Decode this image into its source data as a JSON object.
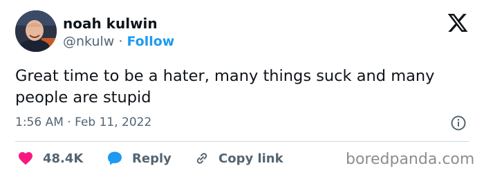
{
  "author": {
    "name": "noah kulwin",
    "handle": "@nkulw",
    "separator": "·",
    "follow_label": "Follow"
  },
  "platform_logo_icon": "x-logo-icon",
  "tweet": {
    "text": "Great time to be a hater, many things suck and many people are stupid",
    "time": "1:56 AM",
    "date": "Feb 11, 2022",
    "meta_separator": "·"
  },
  "actions": {
    "like_count": "48.4K",
    "reply_label": "Reply",
    "copy_link_label": "Copy link"
  },
  "icons": [
    "heart-icon",
    "reply-bubble-icon",
    "link-icon",
    "info-icon"
  ],
  "colors": {
    "accent": "#1d9bf0",
    "like": "#f91880",
    "secondary_text": "#536471",
    "primary_text": "#0f1419"
  },
  "watermark": "boredpanda.com"
}
